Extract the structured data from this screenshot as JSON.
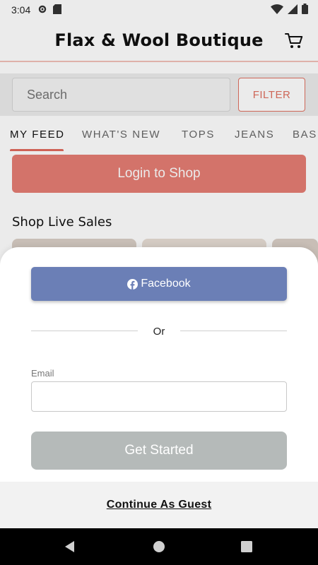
{
  "status_bar": {
    "time": "3:04",
    "icons": [
      "settings-icon",
      "sd-card-icon",
      "wifi-icon",
      "signal-icon",
      "battery-icon"
    ]
  },
  "header": {
    "title": "Flax & Wool Boutique",
    "cart_icon": "cart-icon"
  },
  "search": {
    "placeholder": "Search",
    "filter_label": "FILTER"
  },
  "tabs": [
    {
      "label": "MY FEED",
      "active": true
    },
    {
      "label": "WHAT'S NEW",
      "active": false
    },
    {
      "label": "TOPS",
      "active": false
    },
    {
      "label": "JEANS",
      "active": false
    },
    {
      "label": "BASI",
      "active": false
    }
  ],
  "login_button": "Login to Shop",
  "live_sales": {
    "title": "Shop Live Sales"
  },
  "sheet": {
    "facebook_label": "Facebook",
    "or_label": "Or",
    "email_label": "Email",
    "email_value": "",
    "get_started_label": "Get Started",
    "guest_label": "Continue As Guest"
  },
  "colors": {
    "accent": "#e57d73",
    "facebook": "#6b7fb6",
    "disabled_button": "#b5bab9"
  },
  "nav_bar": {
    "icons": [
      "back-icon",
      "home-icon",
      "recents-icon"
    ]
  }
}
